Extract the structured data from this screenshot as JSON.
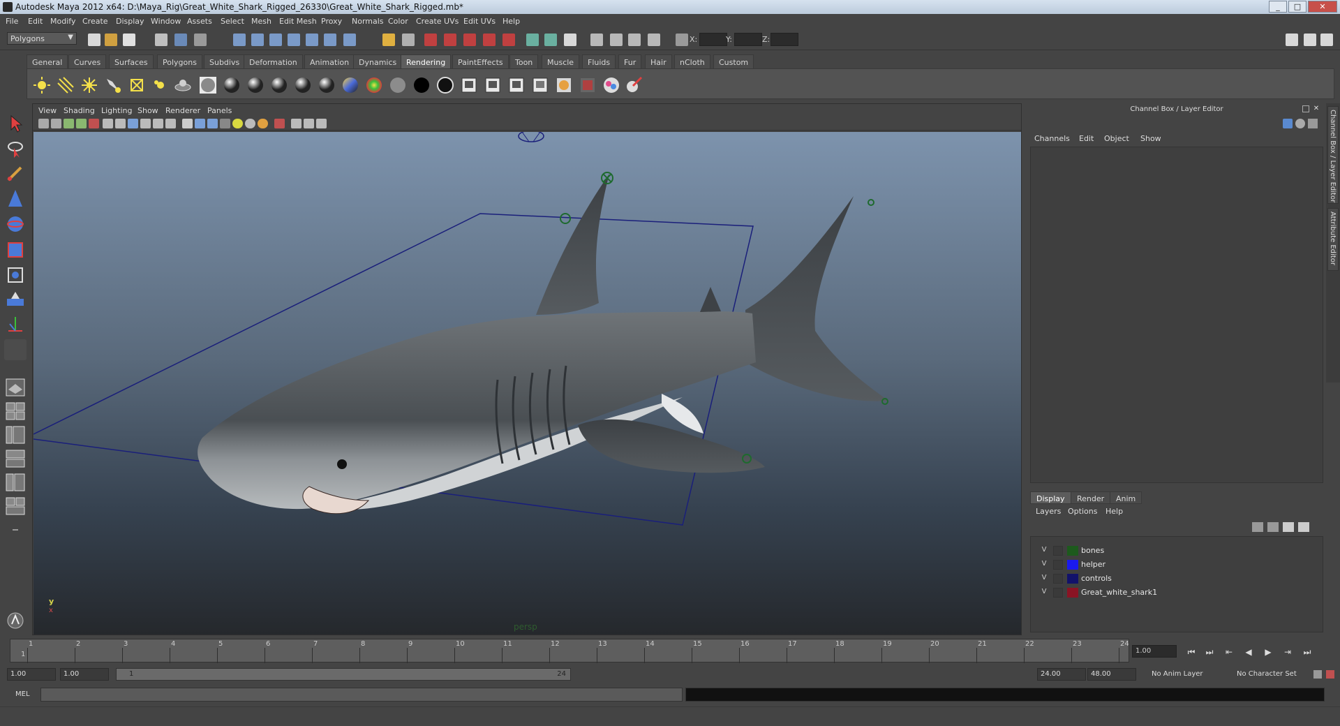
{
  "window": {
    "title": "Autodesk Maya 2012 x64: D:\\Maya_Rig\\Great_White_Shark_Rigged_26330\\Great_White_Shark_Rigged.mb*",
    "buttons": [
      "_",
      "□",
      "✕"
    ]
  },
  "menubar": [
    "File",
    "Edit",
    "Modify",
    "Create",
    "Display",
    "Window",
    "Assets",
    "Select",
    "Mesh",
    "Edit Mesh",
    "Proxy",
    "Normals",
    "Color",
    "Create UVs",
    "Edit UVs",
    "Help"
  ],
  "statusline": {
    "mode": "Polygons",
    "coord_labels": [
      "X:",
      "Y:",
      "Z:"
    ]
  },
  "shelf": {
    "tabs": [
      "General",
      "Curves",
      "Surfaces",
      "Polygons",
      "Subdivs",
      "Deformation",
      "Animation",
      "Dynamics",
      "Rendering",
      "PaintEffects",
      "Toon",
      "Muscle",
      "Fluids",
      "Fur",
      "Hair",
      "nCloth",
      "Custom"
    ],
    "active_tab": "Rendering",
    "icons": [
      "ambient-light",
      "directional-light",
      "point-light",
      "spot-light",
      "area-light",
      "volume-light",
      "ibl",
      "lambert-shader",
      "blinn-shader",
      "phong-shader",
      "phonge-shader",
      "anisotropic-shader",
      "layered-shader",
      "ramp-shader",
      "surface-shader",
      "black-shader",
      "use-background",
      "render-view",
      "render-current",
      "ipr-render",
      "batch-render",
      "hypershade",
      "render-settings",
      "mental-ray",
      "paint-shading"
    ]
  },
  "viewport": {
    "menu": [
      "View",
      "Shading",
      "Lighting",
      "Show",
      "Renderer",
      "Panels"
    ],
    "camera_label": "persp",
    "axis_y": "y",
    "axis_x": "x"
  },
  "rpanel": {
    "header": "Channel Box / Layer Editor",
    "menu": [
      "Channels",
      "Edit",
      "Object",
      "Show"
    ],
    "layer_tabs": [
      "Display",
      "Render",
      "Anim"
    ],
    "active_layer_tab": "Display",
    "layer_menu": [
      "Layers",
      "Options",
      "Help"
    ],
    "layers": [
      {
        "v": "V",
        "name": "bones",
        "color": "#1d5a1d"
      },
      {
        "v": "V",
        "name": "helper",
        "color": "#1a1aee"
      },
      {
        "v": "V",
        "name": "controls",
        "color": "#12126a"
      },
      {
        "v": "V",
        "name": "Great_white_shark1",
        "color": "#8a1424"
      }
    ],
    "side_tabs": [
      "Channel Box / Layer Editor",
      "Attribute Editor"
    ]
  },
  "timeslider": {
    "frames": [
      "1",
      "2",
      "3",
      "4",
      "5",
      "6",
      "7",
      "8",
      "9",
      "10",
      "11",
      "12",
      "13",
      "14",
      "15",
      "16",
      "17",
      "18",
      "19",
      "20",
      "21",
      "22",
      "23",
      "24"
    ],
    "current_frame_marker": "1",
    "current_frame": "1.00",
    "playback_buttons": [
      "⏮",
      "⏭",
      "⇤",
      "◀",
      "▶",
      "⇥",
      "⏭"
    ]
  },
  "rangeslider": {
    "start_time": "1.00",
    "playback_start": "1.00",
    "range_start_label": "1",
    "range_end_label": "24",
    "playback_end": "24.00",
    "end_time": "48.00",
    "anim_layer": "No Anim Layer",
    "character_set": "No Character Set"
  },
  "cmdline": {
    "label": "MEL"
  },
  "colors": {
    "ui_bg": "#444444",
    "shelf_active": "#5e5e5e",
    "viewport_top": "#7d93ad",
    "viewport_bottom": "#25282c",
    "bounding_box": "#1a1f7a"
  }
}
